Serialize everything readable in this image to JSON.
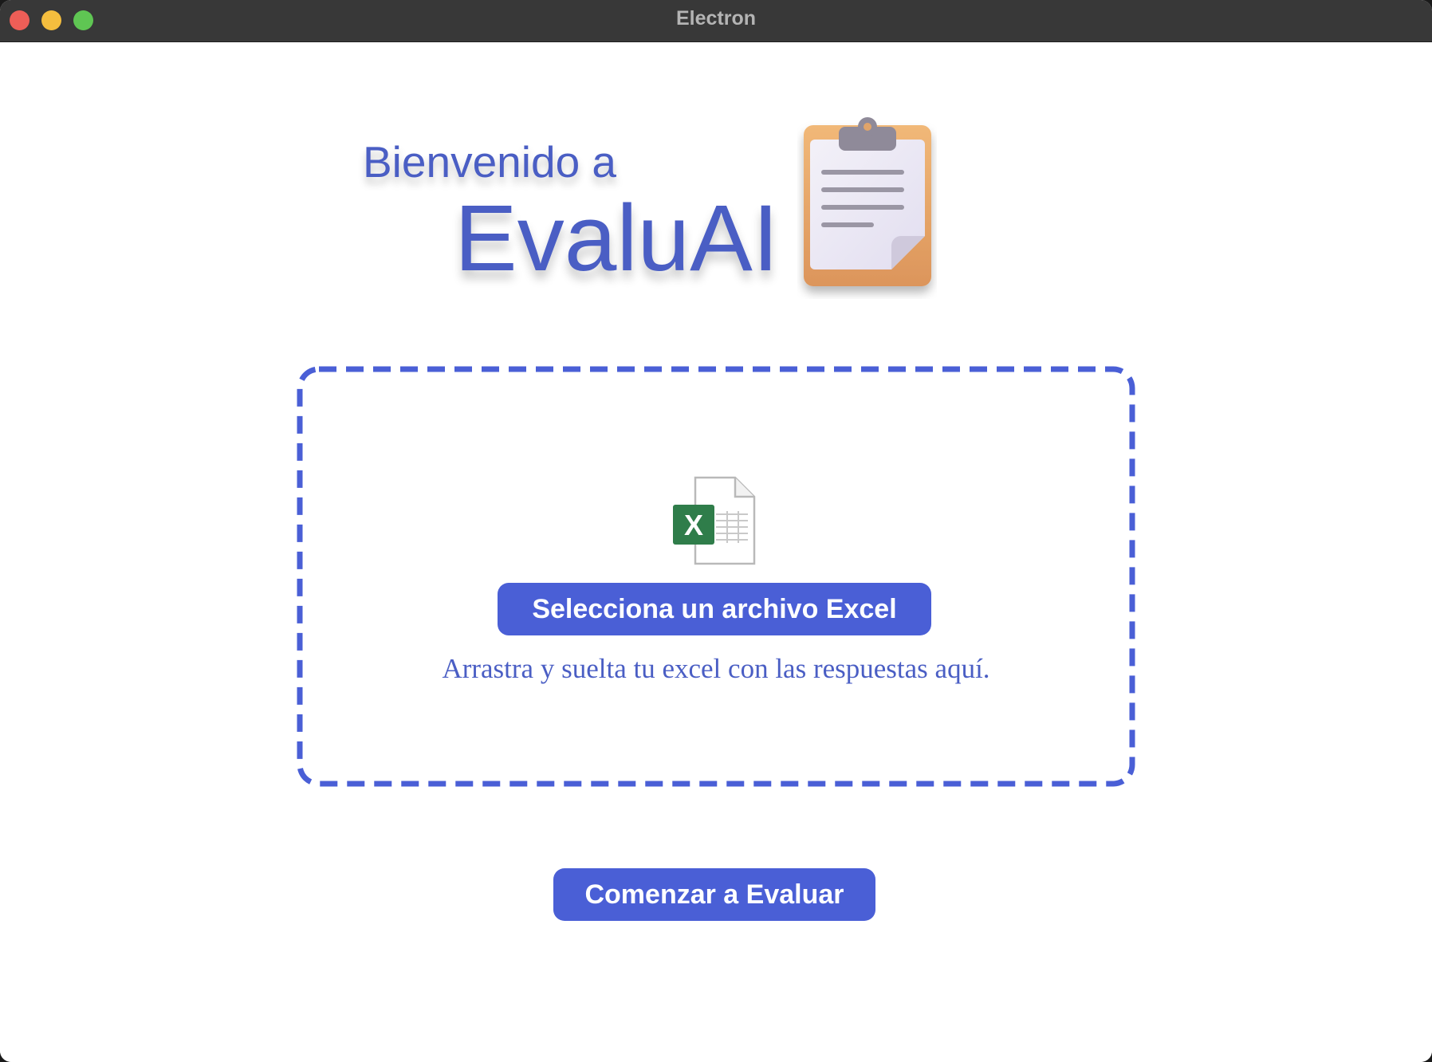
{
  "window": {
    "title": "Electron"
  },
  "header": {
    "welcome_text": "Bienvenido a",
    "app_name": "EvaluAI"
  },
  "dropzone": {
    "select_button_label": "Selecciona un archivo Excel",
    "hint_text": "Arrastra y suelta tu excel con las respuestas aquí.",
    "file_icon": "excel-file-icon",
    "excel_badge_letter": "X"
  },
  "actions": {
    "start_button_label": "Comenzar a Evaluar"
  },
  "colors": {
    "accent": "#4a5fd6",
    "text_accent": "#4a5ec4",
    "excel_green": "#2f7d4a"
  },
  "icons": {
    "logo": "clipboard-icon"
  }
}
